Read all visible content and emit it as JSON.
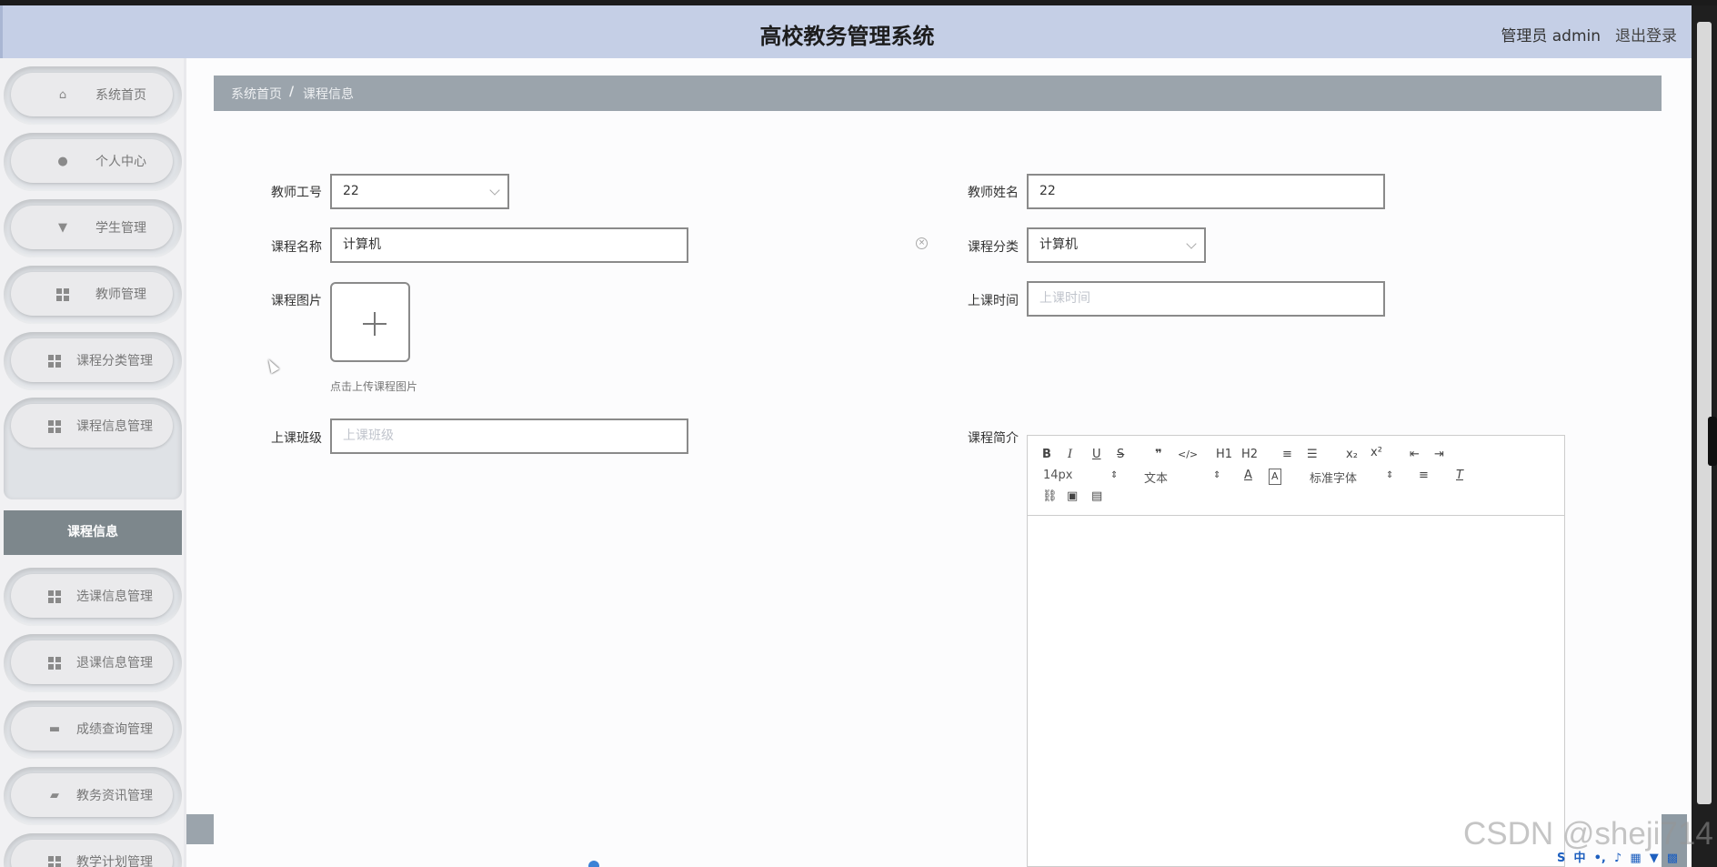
{
  "header": {
    "title": "高校教务管理系统",
    "user": "管理员 admin",
    "logout": "退出登录"
  },
  "sidebar": {
    "items": [
      {
        "label": "系统首页",
        "icon": "home-icon"
      },
      {
        "label": "个人中心",
        "icon": "user-icon"
      },
      {
        "label": "学生管理",
        "icon": "flag-icon"
      },
      {
        "label": "教师管理",
        "icon": "grid-icon"
      },
      {
        "label": "课程分类管理",
        "icon": "grid-icon"
      },
      {
        "label": "课程信息管理",
        "icon": "grid-icon",
        "expanded": true
      },
      {
        "label": "选课信息管理",
        "icon": "grid-icon"
      },
      {
        "label": "退课信息管理",
        "icon": "grid-icon"
      },
      {
        "label": "成绩查询管理",
        "icon": "monitor-icon"
      },
      {
        "label": "教务资讯管理",
        "icon": "mailbox-icon"
      },
      {
        "label": "教学计划管理",
        "icon": "grid-icon"
      }
    ],
    "sub_item": "课程信息"
  },
  "breadcrumb": {
    "home": "系统首页",
    "separator": "/",
    "current": "课程信息"
  },
  "form": {
    "teacher_id": {
      "label": "教师工号",
      "value": "22"
    },
    "teacher_name": {
      "label": "教师姓名",
      "value": "22"
    },
    "course_name": {
      "label": "课程名称",
      "value": "计算机"
    },
    "course_category": {
      "label": "课程分类",
      "value": "计算机"
    },
    "course_image": {
      "label": "课程图片",
      "hint": "点击上传课程图片"
    },
    "class_time": {
      "label": "上课时间",
      "placeholder": "上课时间"
    },
    "class_group": {
      "label": "上课班级",
      "placeholder": "上课班级"
    },
    "course_intro": {
      "label": "课程简介"
    }
  },
  "editor": {
    "font_size": "14px",
    "text_type": "文本",
    "font_family": "标准字体",
    "buttons_row1": [
      "B",
      "I",
      "U",
      "S",
      "❞",
      "</>",
      "H1",
      "H2",
      "ordered-list",
      "bullet-list",
      "subscript",
      "superscript",
      "outdent",
      "indent"
    ]
  },
  "watermark": "CSDN @sheji714",
  "colors": {
    "header_bg": "#c5cfe6",
    "breadcrumb_bg": "#9ba4ac",
    "active_sub_bg": "#7d878c"
  }
}
